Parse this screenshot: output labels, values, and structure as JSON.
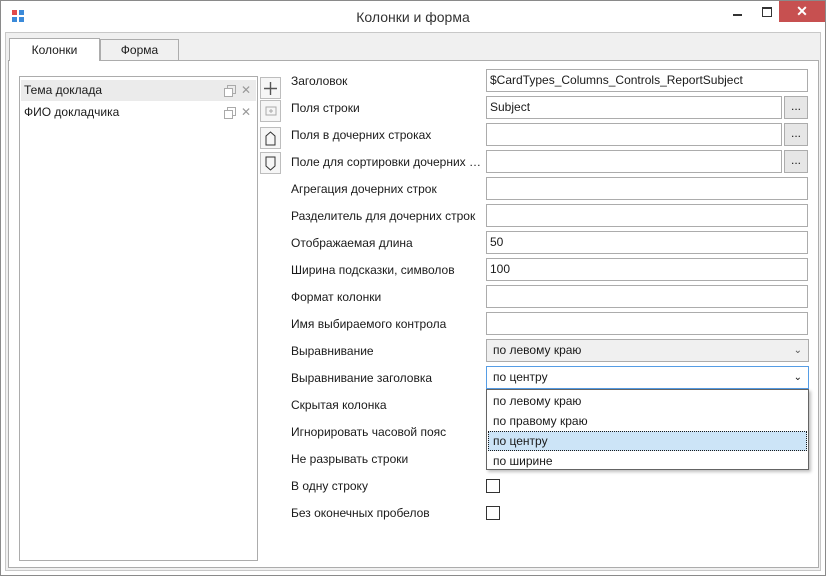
{
  "window": {
    "title": "Колонки и форма",
    "colors": {
      "close": "#c75050",
      "accent": "#569de5"
    }
  },
  "tabs": [
    {
      "label": "Колонки",
      "active": true
    },
    {
      "label": "Форма",
      "active": false
    }
  ],
  "columns": [
    {
      "label": "Тема доклада",
      "selected": true
    },
    {
      "label": "ФИО докладчика",
      "selected": false
    }
  ],
  "side_buttons": [
    {
      "icon": "plus-icon"
    },
    {
      "icon": "add-child-icon"
    },
    {
      "icon": "move-up-icon"
    },
    {
      "icon": "move-down-icon"
    }
  ],
  "properties": {
    "header": {
      "label": "Заголовок",
      "value": "$CardTypes_Columns_Controls_ReportSubject"
    },
    "row_fields": {
      "label": "Поля строки",
      "value": "Subject",
      "button": "..."
    },
    "child_row_fields": {
      "label": "Поля в дочерних строках",
      "value": "",
      "button": "..."
    },
    "child_sort_fields": {
      "label": "Поле для сортировки дочерних строк",
      "value": "",
      "button": "..."
    },
    "child_aggregation": {
      "label": "Агрегация дочерних строк",
      "value": ""
    },
    "child_separator": {
      "label": "Разделитель для дочерних строк",
      "value": ""
    },
    "display_length": {
      "label": "Отображаемая длина",
      "value": "50"
    },
    "hint_width": {
      "label": "Ширина подсказки, символов",
      "value": "100"
    },
    "column_format": {
      "label": "Формат колонки",
      "value": ""
    },
    "selectable_control": {
      "label": "Имя выбираемого контрола",
      "value": ""
    },
    "alignment": {
      "label": "Выравнивание",
      "value": "по левому краю"
    },
    "header_alignment": {
      "label": "Выравнивание заголовка",
      "value": "по центру",
      "options": [
        "по левому краю",
        "по правому краю",
        "по центру",
        "по ширине"
      ],
      "highlighted": "по центру"
    },
    "hidden_column": {
      "label": "Скрытая колонка"
    },
    "ignore_timezone": {
      "label": "Игнорировать часовой пояс"
    },
    "no_wrap": {
      "label": "Не разрывать строки"
    },
    "single_line": {
      "label": "В одну строку",
      "checked": false
    },
    "no_trailing_spaces": {
      "label": "Без оконечных пробелов",
      "checked": false
    }
  }
}
